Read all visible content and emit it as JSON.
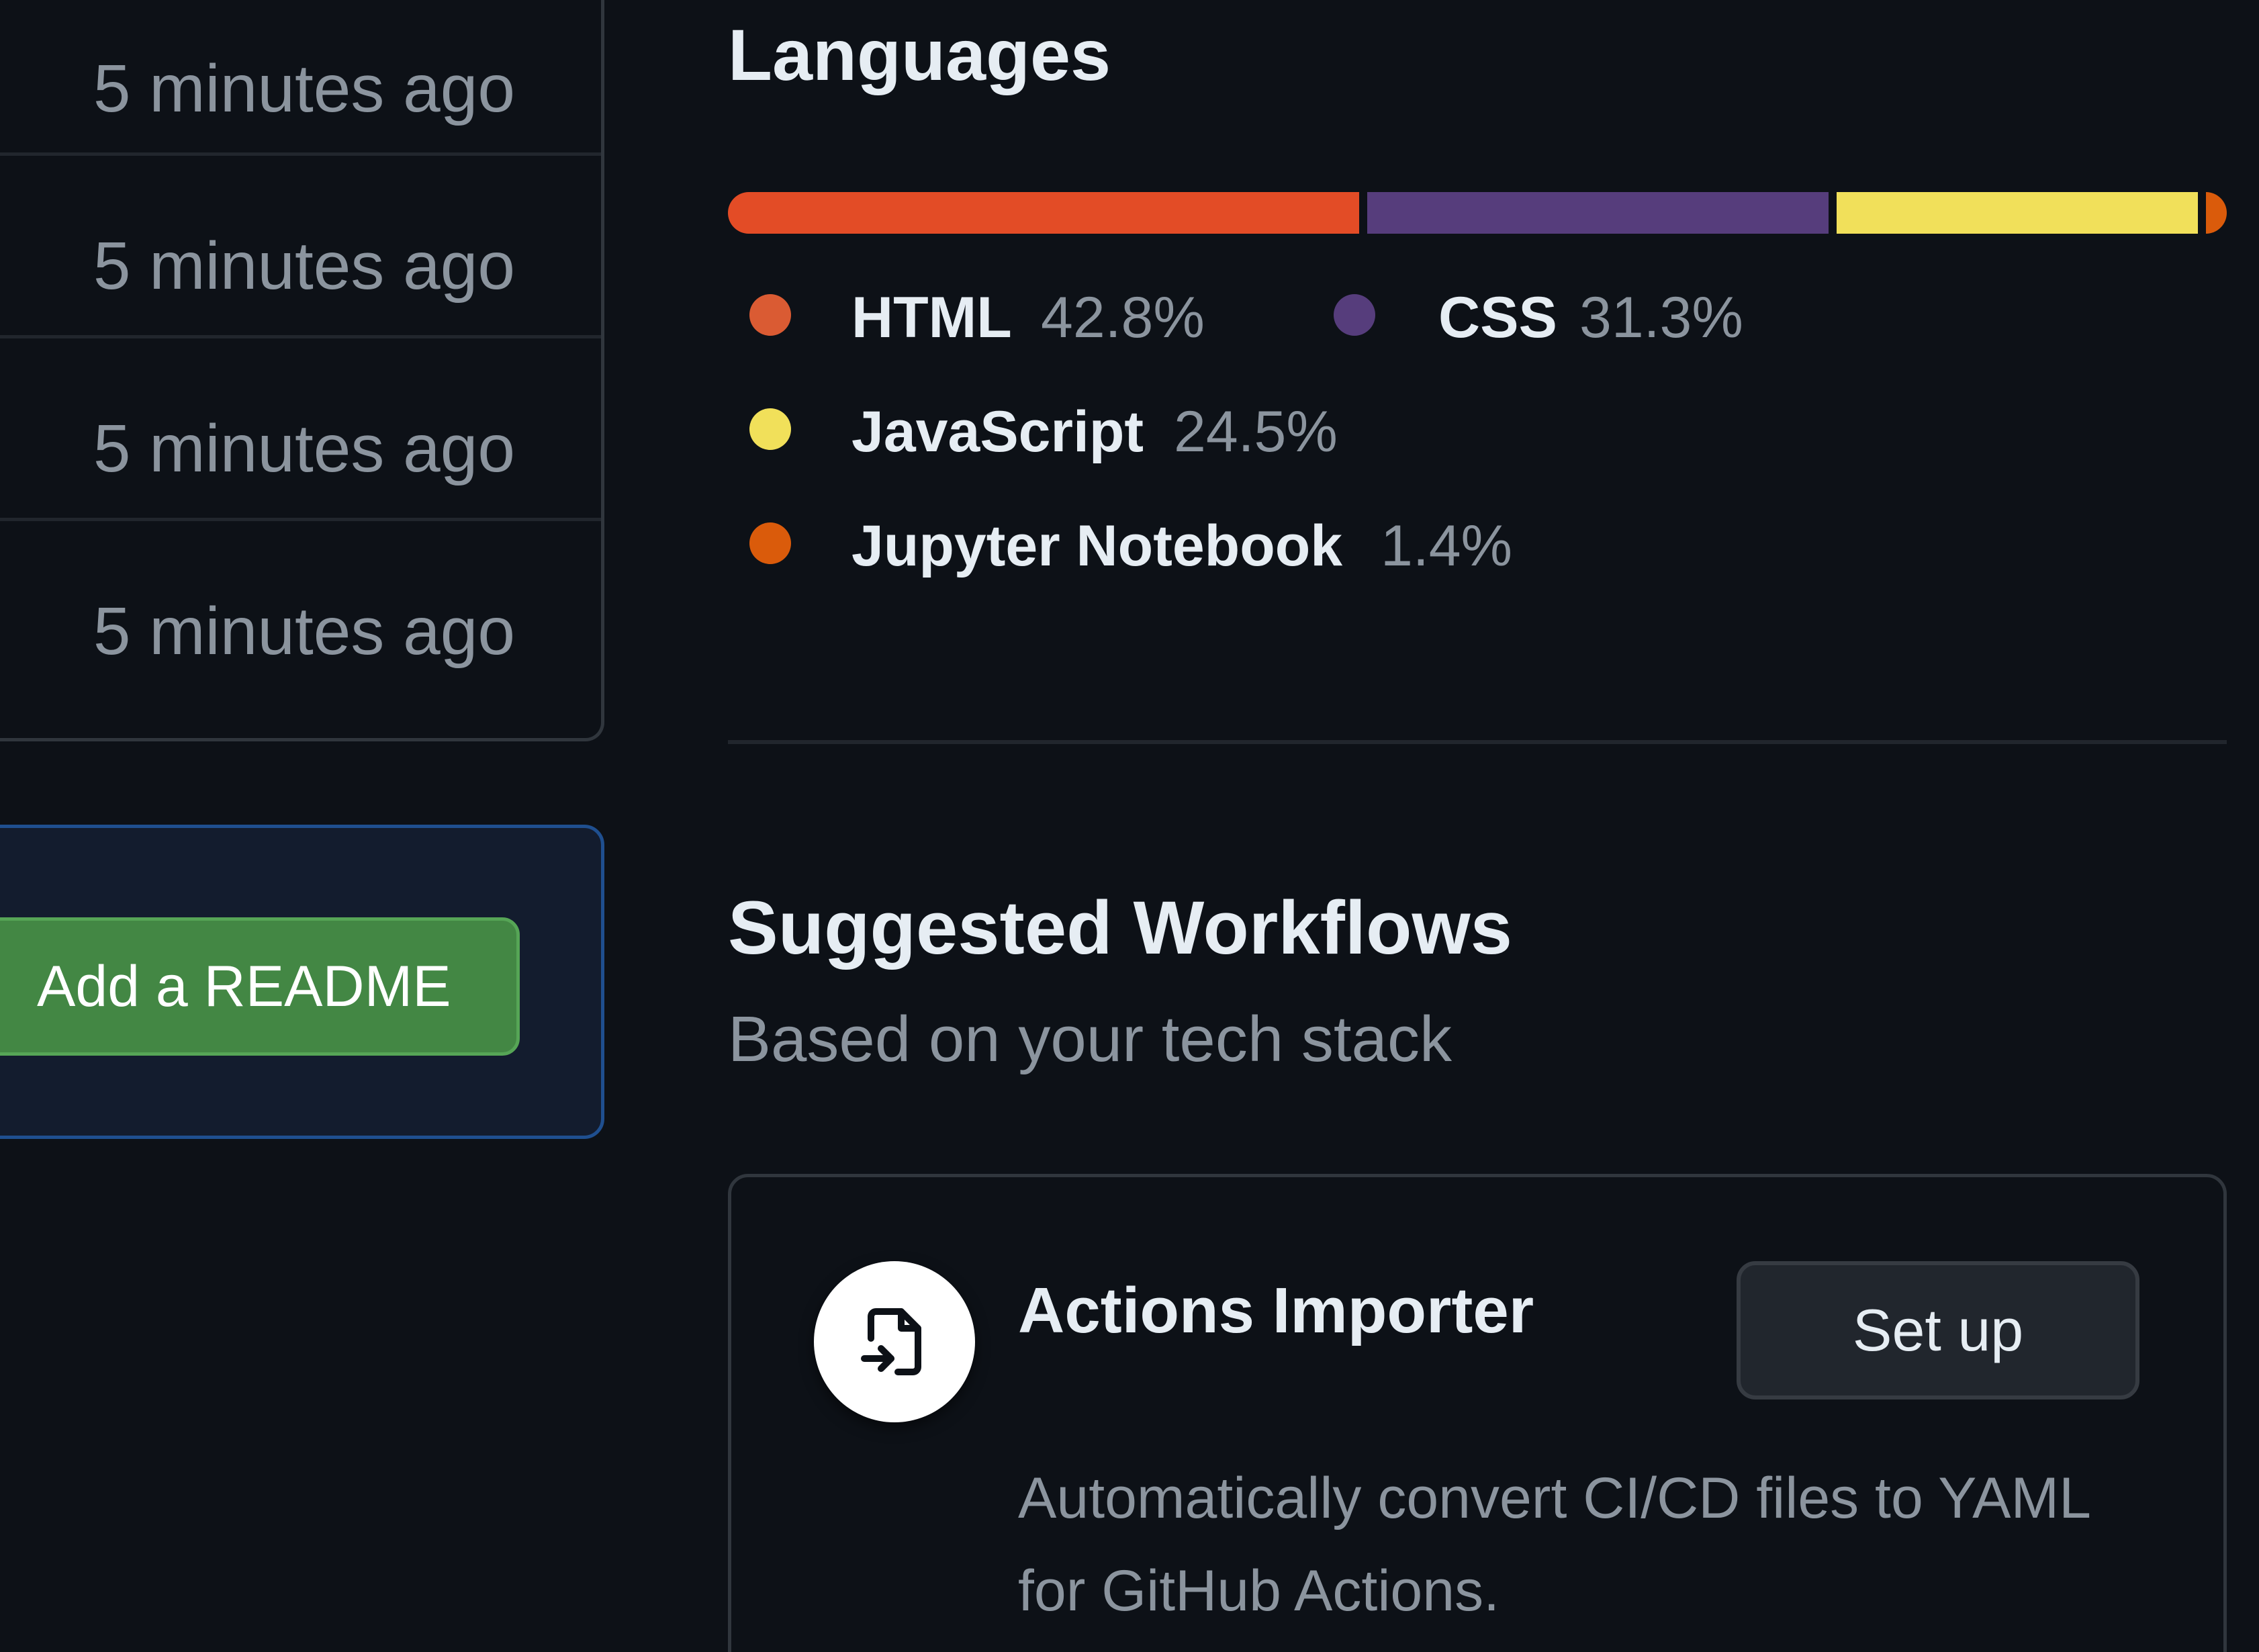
{
  "file_list": {
    "rows": [
      {
        "time": "5 minutes ago"
      },
      {
        "time": "5 minutes ago"
      },
      {
        "time": "5 minutes ago"
      },
      {
        "time": "5 minutes ago"
      }
    ]
  },
  "readme": {
    "button_label": "Add a README"
  },
  "languages": {
    "title": "Languages",
    "items": [
      {
        "name": "HTML",
        "percent": "42.8%",
        "value": 42.8,
        "color": "#e34c26"
      },
      {
        "name": "CSS",
        "percent": "31.3%",
        "value": 31.3,
        "color": "#563d7c"
      },
      {
        "name": "JavaScript",
        "percent": "24.5%",
        "value": 24.5,
        "color": "#f1e05a"
      },
      {
        "name": "Jupyter Notebook",
        "percent": "1.4%",
        "value": 1.4,
        "color": "#da5b0b"
      }
    ]
  },
  "workflows": {
    "title": "Suggested Workflows",
    "subtitle": "Based on your tech stack",
    "items": [
      {
        "name": "Actions Importer",
        "icon": "file-import-icon",
        "button_label": "Set up",
        "description": "Automatically convert CI/CD files to YAML for GitHub Actions."
      }
    ]
  }
}
